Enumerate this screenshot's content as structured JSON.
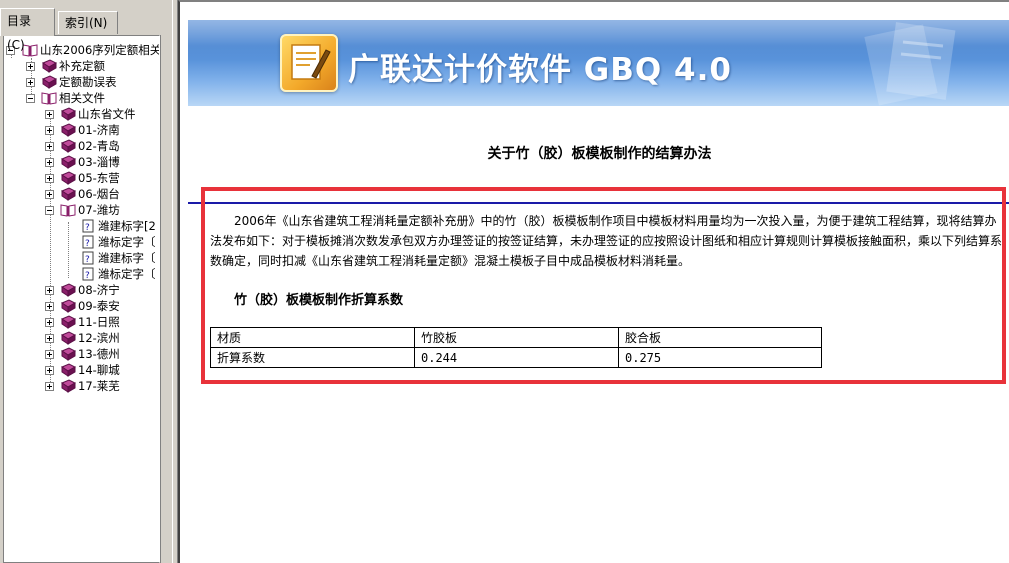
{
  "tabs": {
    "contents": "目录(C)",
    "index": "索引(N)"
  },
  "tree": {
    "root": "山东2006序列定额相关",
    "level1": [
      {
        "label": "补充定额",
        "state": "collapsed"
      },
      {
        "label": "定额勘误表",
        "state": "collapsed"
      },
      {
        "label": "相关文件",
        "state": "expanded"
      }
    ],
    "files": [
      "山东省文件",
      "01-济南",
      "02-青岛",
      "03-淄博",
      "05-东营",
      "06-烟台",
      "07-潍坊",
      "08-济宁",
      "09-泰安",
      "11-日照",
      "12-滨州",
      "13-德州",
      "14-聊城",
      "17-莱芜"
    ],
    "weifang_docs": [
      "潍建标字[2",
      "潍标定字〔",
      "潍建标字〔",
      "潍标定字〔"
    ]
  },
  "banner": {
    "title": "广联达计价软件 GBQ 4.0"
  },
  "document": {
    "title": "关于竹（胶）板模板制作的结算办法",
    "paragraph": "2006年《山东省建筑工程消耗量定额补充册》中的竹（胶）板模板制作项目中模板材料用量均为一次投入量，为便于建筑工程结算，现将结算办法发布如下：对于模板摊消次数发承包双方办理签证的按签证结算，未办理签证的应按照设计图纸和相应计算规则计算模板接触面积，乘以下列结算系数确定，同时扣减《山东省建筑工程消耗量定额》混凝土模板子目中成品模板材料消耗量。",
    "subheading": "竹（胶）板模板制作折算系数",
    "table": {
      "header": [
        "材质",
        "竹胶板",
        "胶合板"
      ],
      "row": [
        "折算系数",
        "0.244",
        "0.275"
      ]
    }
  },
  "colors": {
    "highlight": "#e8323a",
    "rule": "#1a1aa8",
    "book": "#8a1f6a"
  }
}
